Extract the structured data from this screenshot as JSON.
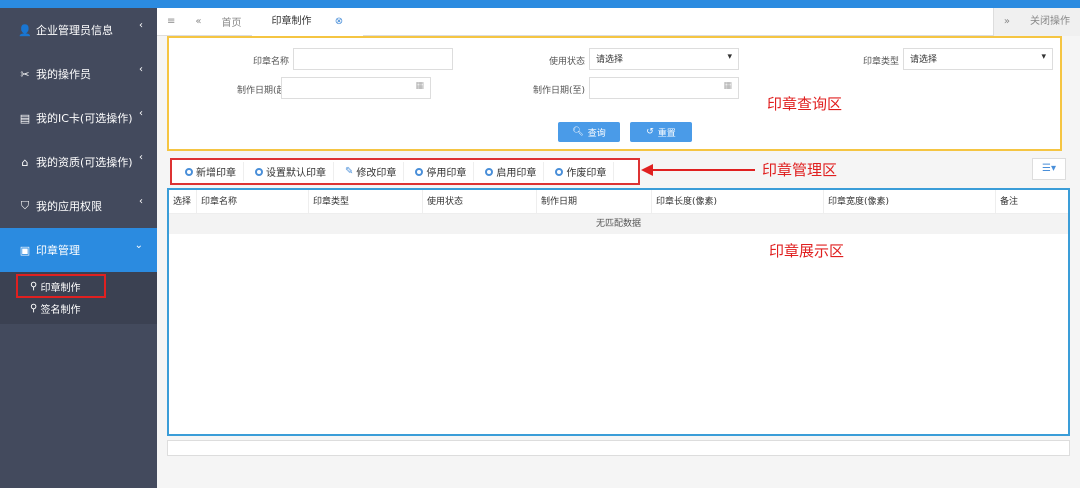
{
  "sidebar": {
    "items": [
      {
        "label": "企业管理员信息",
        "icon": "user-icon"
      },
      {
        "label": "我的操作员",
        "icon": "tools-icon"
      },
      {
        "label": "我的IC卡(可选操作)",
        "icon": "id-card-icon"
      },
      {
        "label": "我的资质(可选操作)",
        "icon": "home-icon"
      },
      {
        "label": "我的应用权限",
        "icon": "shield-icon"
      },
      {
        "label": "印章管理",
        "icon": "seal-icon"
      }
    ],
    "subitems": [
      {
        "label": "印章制作"
      },
      {
        "label": "签名制作"
      }
    ]
  },
  "tabs": {
    "home": "首页",
    "active": "印章制作",
    "close_ops": "关闭操作"
  },
  "query": {
    "name_label": "印章名称",
    "status_label": "使用状态",
    "type_label": "印章类型",
    "date_from_label": "制作日期(起)",
    "date_to_label": "制作日期(至)",
    "status_value": "请选择",
    "type_value": "请选择",
    "search": "查询",
    "reset": "重置"
  },
  "annotations": {
    "query": "印章查询区",
    "manage": "印章管理区",
    "display": "印章展示区"
  },
  "toolbar": [
    "新增印章",
    "设置默认印章",
    "修改印章",
    "停用印章",
    "启用印章",
    "作废印章"
  ],
  "table": {
    "columns": [
      "选择",
      "印章名称",
      "印章类型",
      "使用状态",
      "制作日期",
      "印章长度(像素)",
      "印章宽度(像素)",
      "备注"
    ],
    "empty": "无匹配数据"
  },
  "colors": {
    "accent": "#2b8be0",
    "sidebar": "#434a5d",
    "highlight": "#e02020",
    "query_border": "#f5c542"
  }
}
